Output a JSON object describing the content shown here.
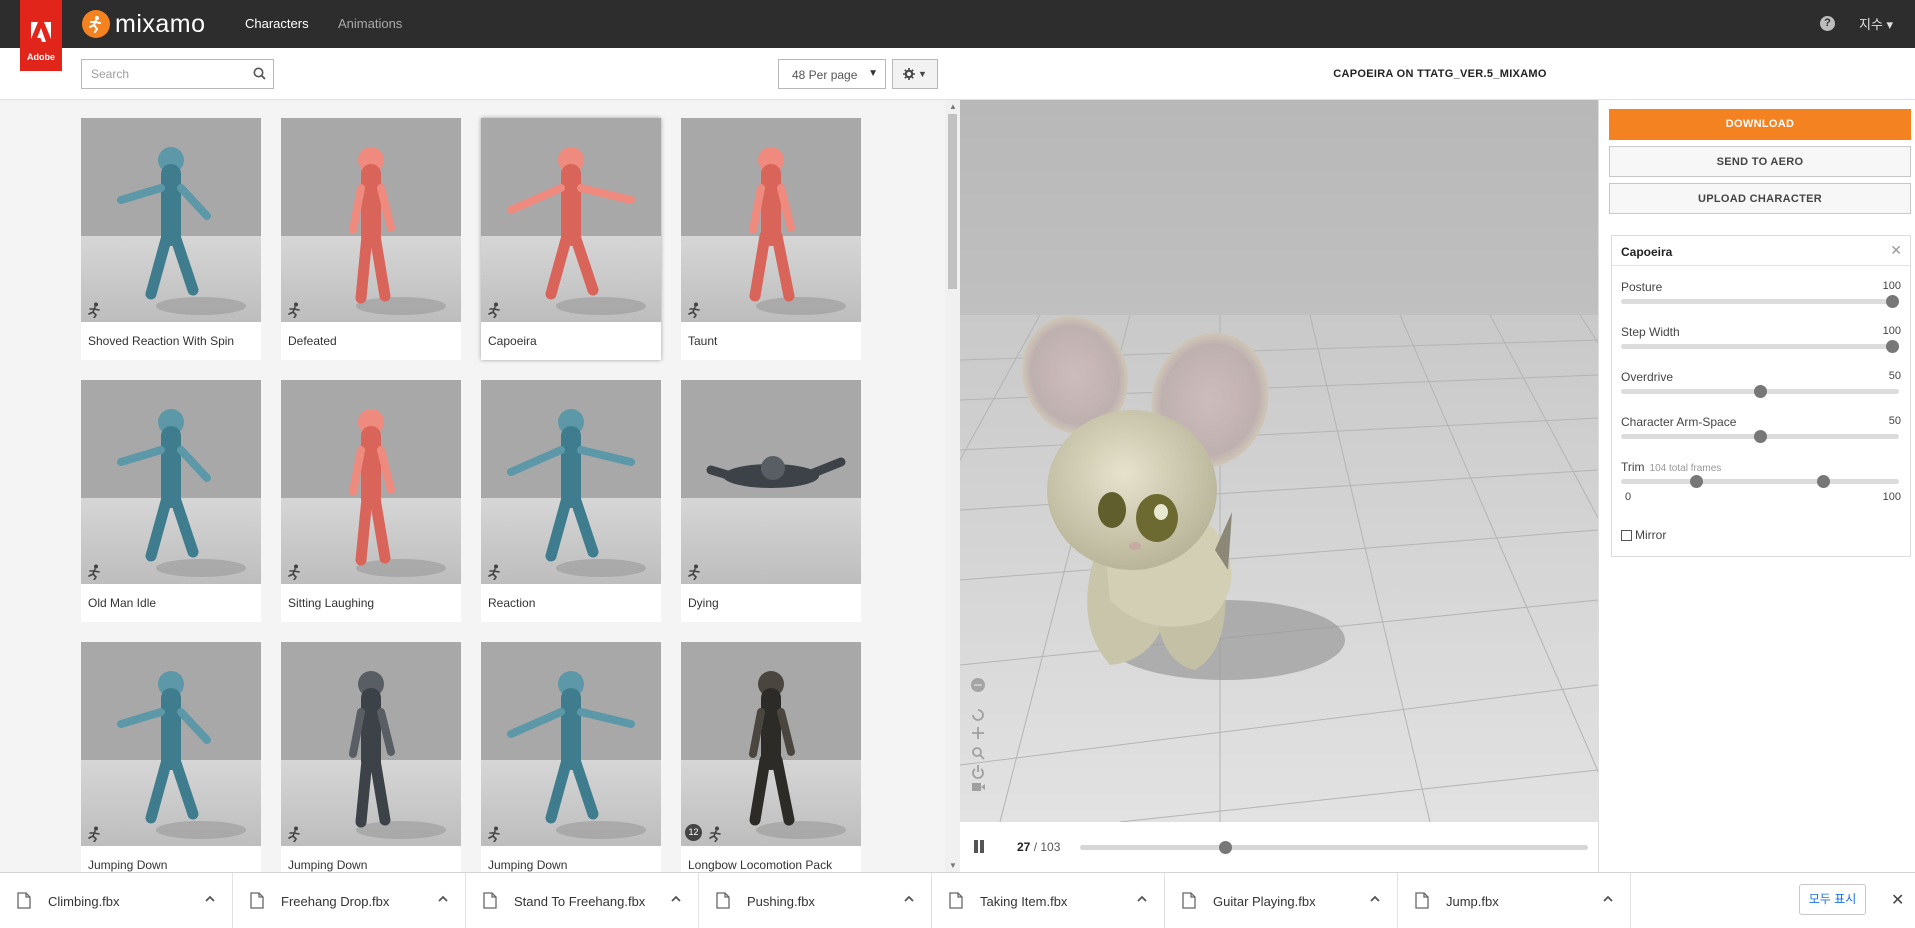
{
  "brand": {
    "adobe_label": "Adobe",
    "app_name": "mixamo",
    "accent": "#f58220",
    "adobe_red": "#e1251b"
  },
  "nav": {
    "characters": "Characters",
    "animations": "Animations",
    "help_icon": "?",
    "user": "지수"
  },
  "toolbar": {
    "search_placeholder": "Search",
    "search_value": "",
    "per_page": "48 Per page",
    "settings_icon": "gear-icon"
  },
  "grid": {
    "cards": [
      {
        "label": "Shoved Reaction With Spin",
        "figure": "blue"
      },
      {
        "label": "Defeated",
        "figure": "red"
      },
      {
        "label": "Capoeira",
        "figure": "red",
        "selected": true
      },
      {
        "label": "Taunt",
        "figure": "red"
      },
      {
        "label": "Old Man Idle",
        "figure": "blue"
      },
      {
        "label": "Sitting Laughing",
        "figure": "red"
      },
      {
        "label": "Reaction",
        "figure": "blue"
      },
      {
        "label": "Dying",
        "figure": "soldier"
      },
      {
        "label": "Jumping Down",
        "figure": "blue"
      },
      {
        "label": "Jumping Down",
        "figure": "soldier"
      },
      {
        "label": "Jumping Down",
        "figure": "blue"
      },
      {
        "label": "Longbow Locomotion Pack",
        "figure": "archer",
        "pack_count": "12"
      }
    ]
  },
  "viewer": {
    "title": "CAPOEIRA ON TTATG_VER.5_MIXAMO",
    "frame_current": "27",
    "frame_total": "/ 103",
    "timeline_progress": 0.28
  },
  "actions": {
    "download": "DOWNLOAD",
    "send_to_aero": "SEND TO AERO",
    "upload_character": "UPLOAD CHARACTER"
  },
  "params": {
    "title": "Capoeira",
    "posture": {
      "label": "Posture",
      "value": "100",
      "level": 1.0
    },
    "step_width": {
      "label": "Step Width",
      "value": "100",
      "level": 1.0
    },
    "overdrive": {
      "label": "Overdrive",
      "value": "50",
      "level": 0.5
    },
    "arm_space": {
      "label": "Character Arm-Space",
      "value": "50",
      "level": 0.5
    },
    "trim": {
      "label": "Trim",
      "sub": "104 total frames",
      "min": "0",
      "max": "100",
      "start": 0.26,
      "end": 0.74
    },
    "mirror": "Mirror"
  },
  "downloads": {
    "items": [
      "Climbing.fbx",
      "Freehang Drop.fbx",
      "Stand To Freehang.fbx",
      "Pushing.fbx",
      "Taking Item.fbx",
      "Guitar Playing.fbx",
      "Jump.fbx"
    ],
    "show_all": "모두 표시",
    "close": "✕"
  }
}
